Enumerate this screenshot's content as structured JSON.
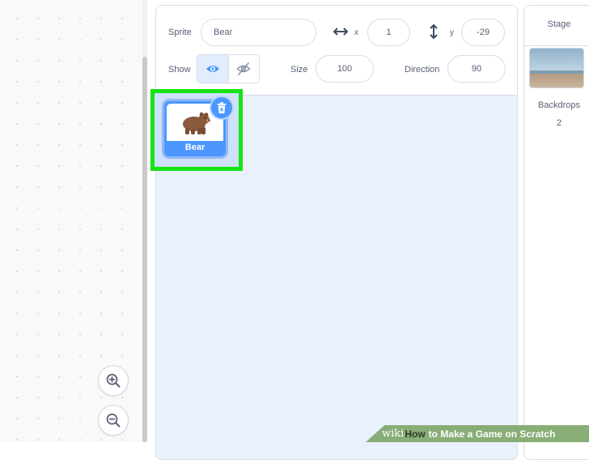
{
  "sprite_info": {
    "sprite_label": "Sprite",
    "sprite_name": "Bear",
    "x_label": "x",
    "x_value": "1",
    "y_label": "y",
    "y_value": "-29",
    "show_label": "Show",
    "size_label": "Size",
    "size_value": "100",
    "direction_label": "Direction",
    "direction_value": "90"
  },
  "sprites": [
    {
      "name": "Bear",
      "selected": true
    }
  ],
  "stage": {
    "title": "Stage",
    "backdrops_label": "Backdrops",
    "backdrops_count": "2"
  },
  "watermark": {
    "wiki": "wiki",
    "how": "How",
    "rest": "to Make a Game on Scratch"
  },
  "colors": {
    "accent": "#4c97ff",
    "highlight": "#14e414",
    "sprite_pane_bg": "#e9f1fc"
  },
  "icons": [
    "zoom-in-icon",
    "zoom-out-icon",
    "horizontal-arrows-icon",
    "vertical-arrows-icon",
    "eye-icon",
    "eye-slash-icon",
    "trash-icon",
    "bear-icon"
  ]
}
